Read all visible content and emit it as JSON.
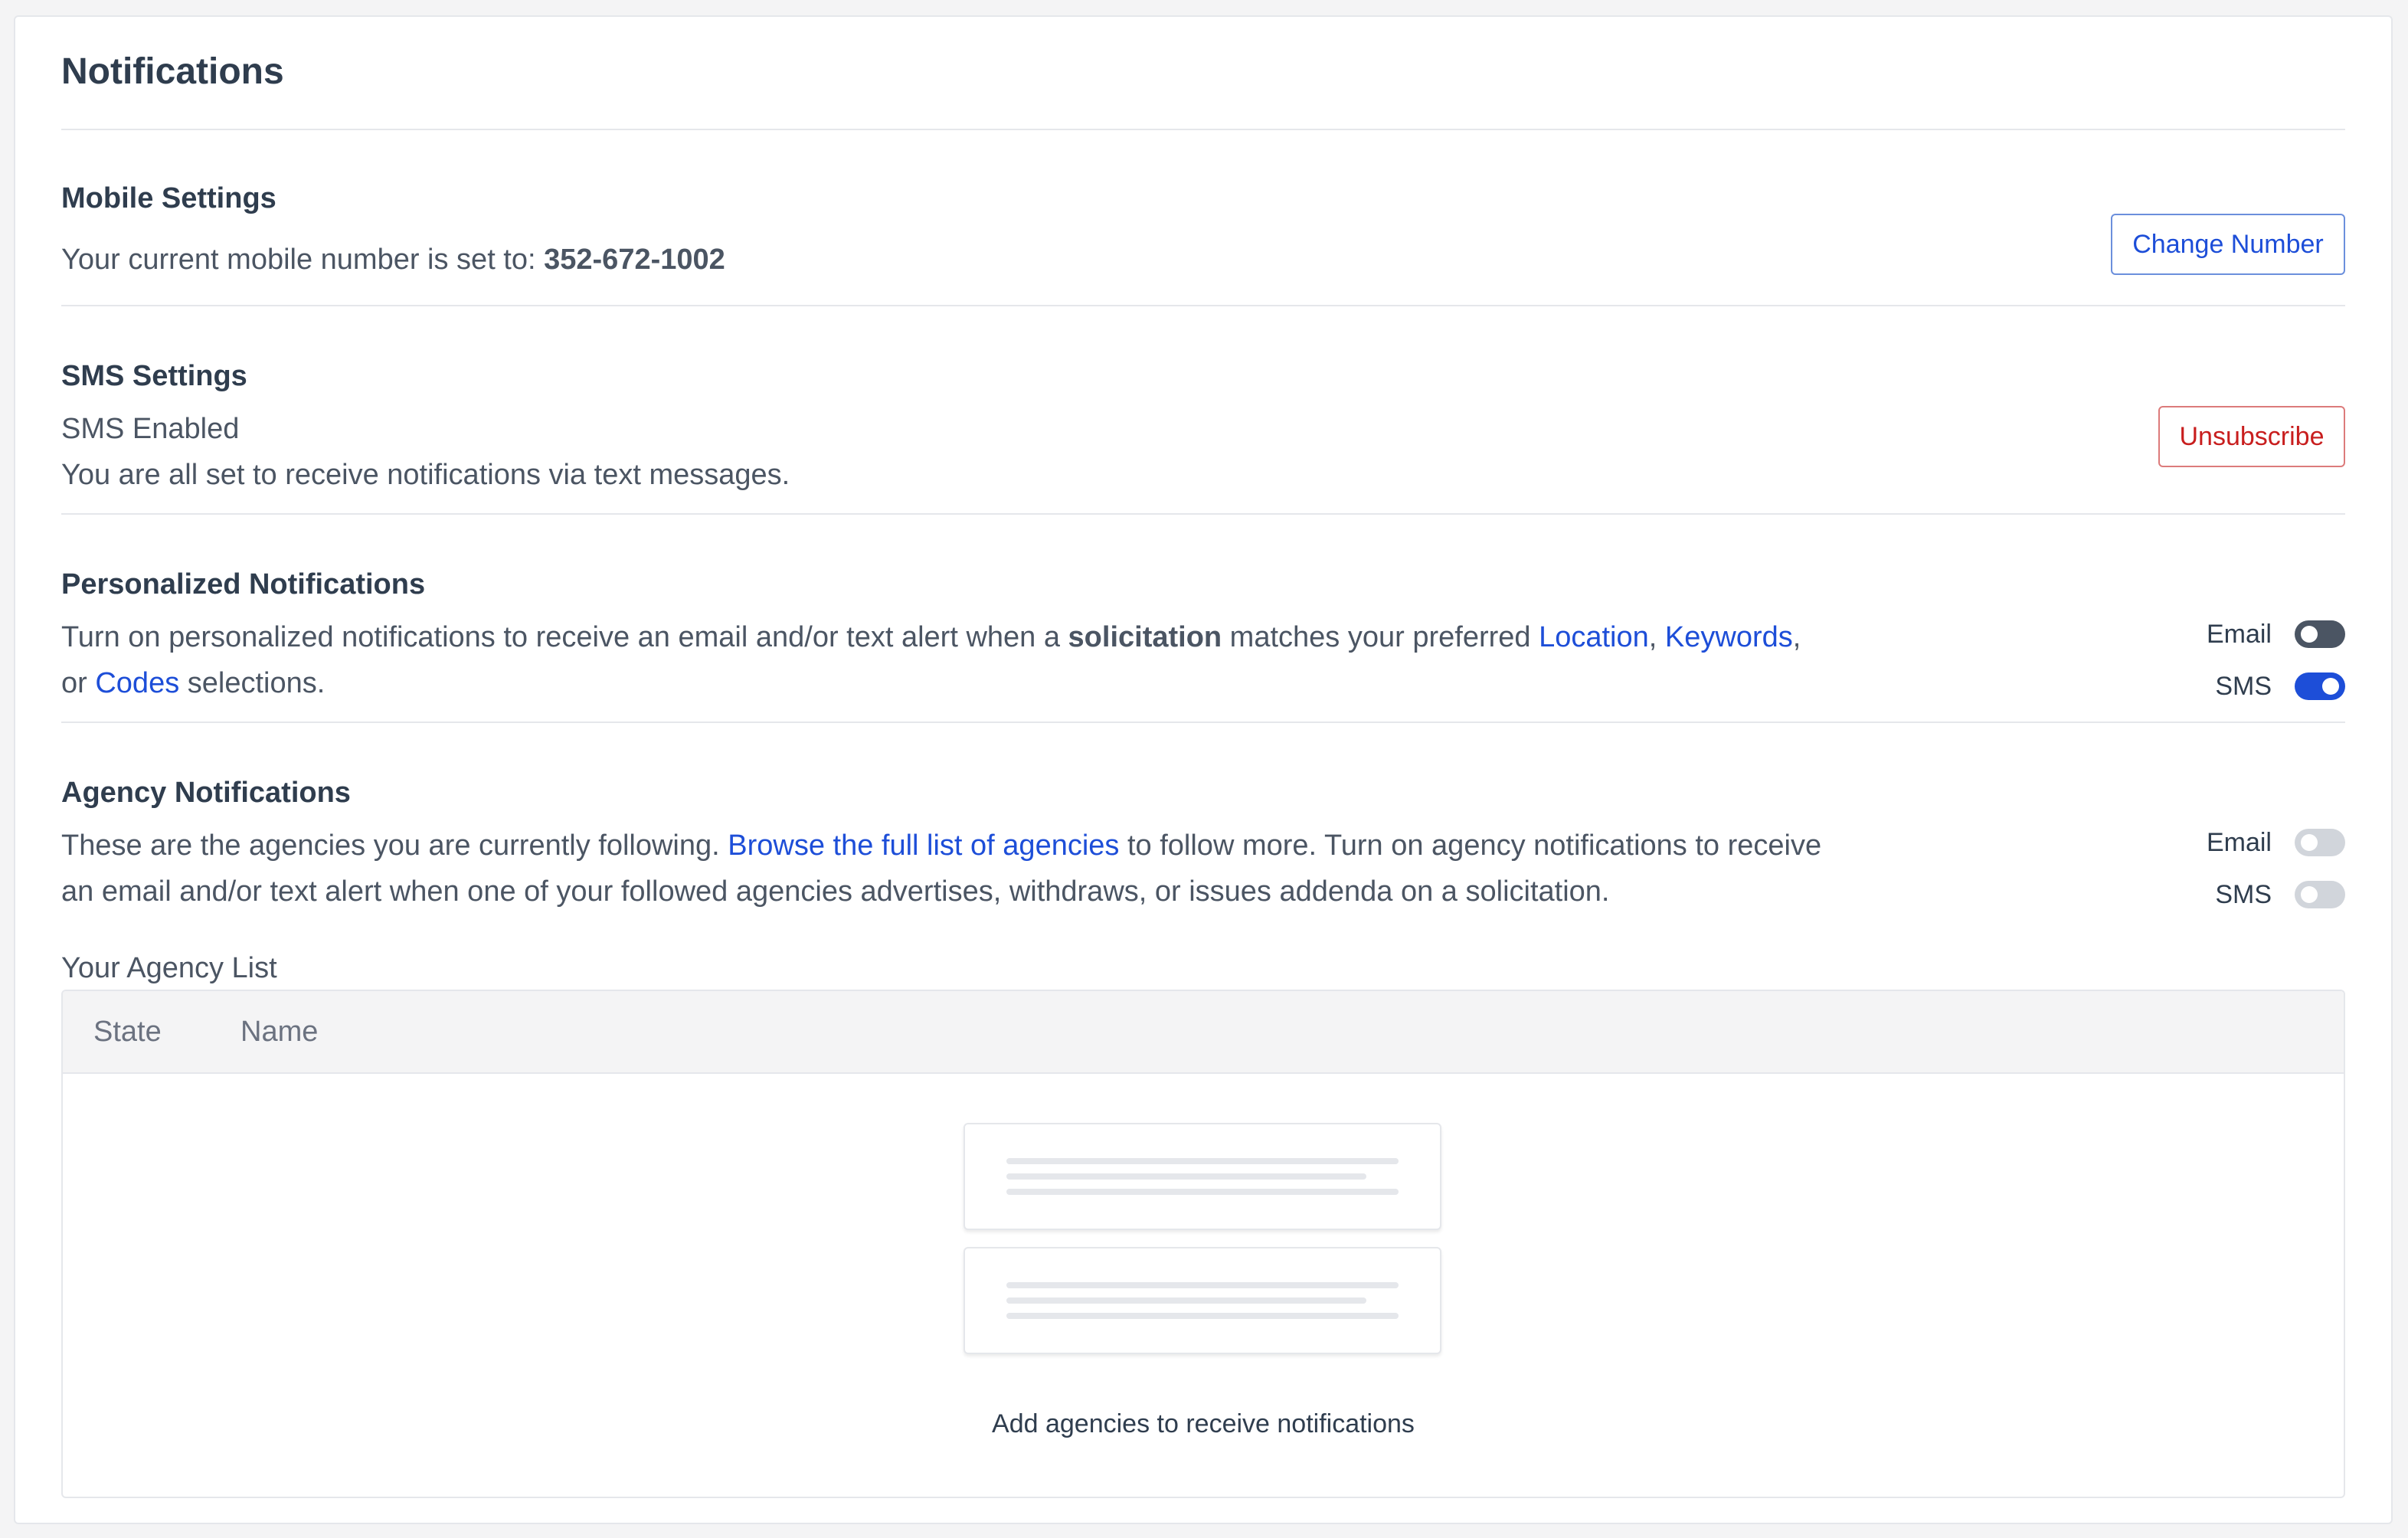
{
  "page": {
    "title": "Notifications"
  },
  "mobile_settings": {
    "title": "Mobile Settings",
    "text_prefix": "Your current mobile number is set to: ",
    "phone": "352-672-1002",
    "change_button": "Change Number"
  },
  "sms_settings": {
    "title": "SMS Settings",
    "status": "SMS Enabled",
    "description": "You are all set to receive notifications via text messages.",
    "unsubscribe_button": "Unsubscribe"
  },
  "personalized": {
    "title": "Personalized Notifications",
    "text_1": "Turn on personalized notifications to receive an email and/or text alert when a ",
    "bold": "solicitation",
    "text_2": " matches your preferred ",
    "link_location": "Location",
    "sep_1": ", ",
    "link_keywords": "Keywords",
    "sep_2": ",",
    "text_3": "or ",
    "link_codes": "Codes",
    "text_4": " selections.",
    "email_label": "Email",
    "email_on": false,
    "sms_label": "SMS",
    "sms_on": true
  },
  "agency": {
    "title": "Agency Notifications",
    "text_1": "These are the agencies you are currently following. ",
    "link_browse": "Browse the full list of agencies",
    "text_2": " to follow more. Turn on agency notifications to receive",
    "text_3": "an email and/or text alert when one of your followed agencies advertises, withdraws, or issues addenda on a solicitation.",
    "email_label": "Email",
    "email_on": false,
    "sms_label": "SMS",
    "sms_on": false,
    "list_title": "Your Agency List",
    "columns": [
      "State",
      "Name"
    ],
    "empty_message": "Add agencies to receive notifications"
  },
  "colors": {
    "link": "#1d4ed8",
    "danger": "#c81e1e",
    "heading": "#2f3d4e",
    "toggle_on": "#1d4ed8"
  }
}
